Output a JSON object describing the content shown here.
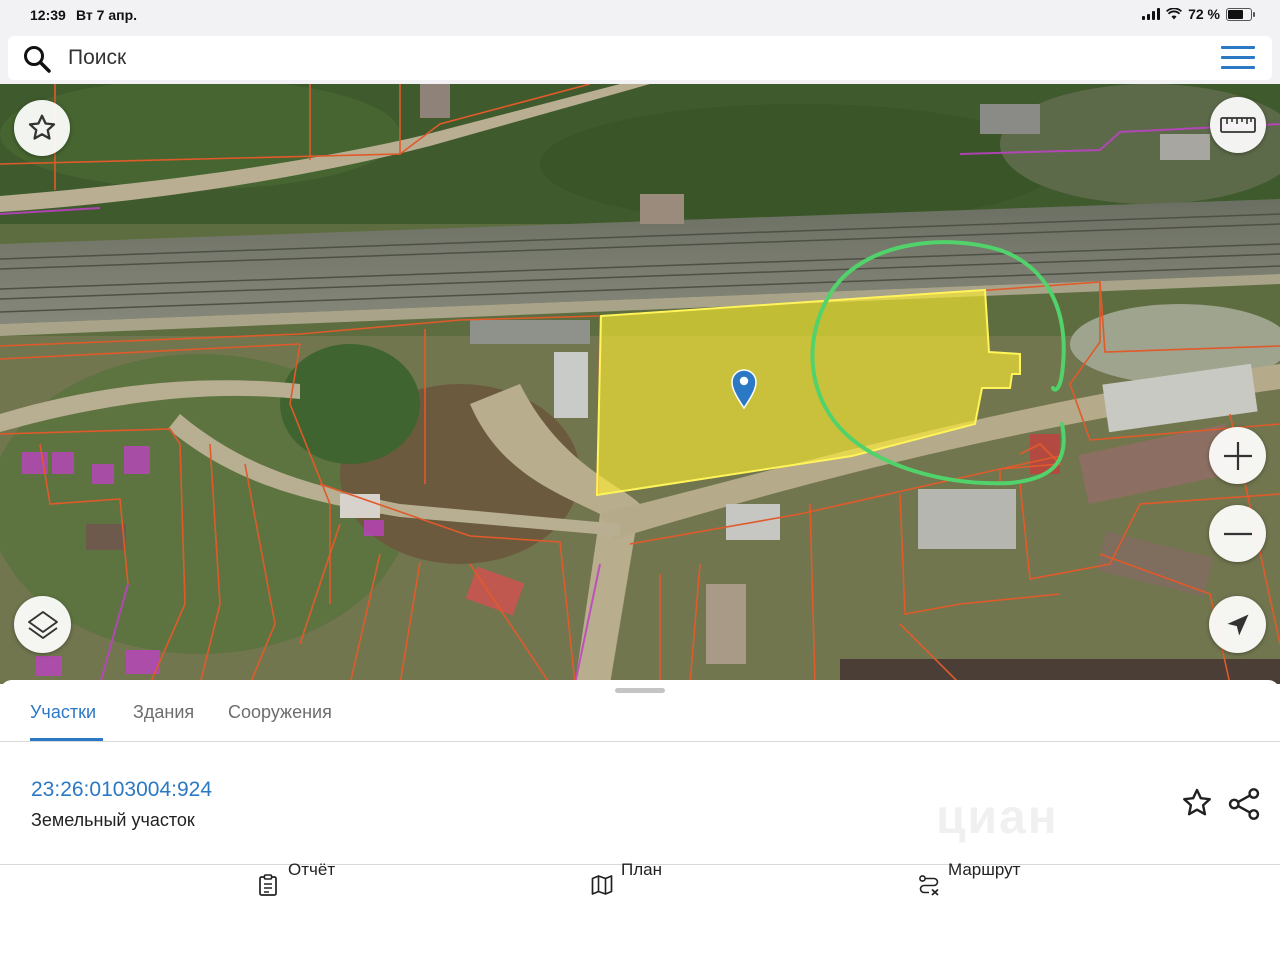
{
  "status": {
    "time": "12:39",
    "date": "Вт 7 апр.",
    "battery": "72 %",
    "battery_level": 0.72
  },
  "search": {
    "placeholder": "Поиск",
    "icon": "search-icon",
    "menu_icon": "menu-icon"
  },
  "map": {
    "controls": {
      "favorite": "star-icon",
      "layers": "layers-icon",
      "ruler": "ruler-icon",
      "zoom_in": "plus-icon",
      "zoom_out": "minus-icon",
      "locate": "location-arrow-icon"
    },
    "colors": {
      "parcel_border": "#e05a2a",
      "selected_fill": "#ffef2e",
      "selected_stroke": "#fff45a",
      "marker": "#2b78c5",
      "annotation": "#52d26a",
      "purple_zone": "#c040c8"
    }
  },
  "panel": {
    "tabs": [
      {
        "label": "Участки",
        "active": true
      },
      {
        "label": "Здания",
        "active": false
      },
      {
        "label": "Сооружения",
        "active": false
      }
    ],
    "cadastral_number": "23:26:0103004:924",
    "object_type": "Земельный участок",
    "actions": [
      {
        "label": "Отчёт",
        "icon": "clipboard-icon"
      },
      {
        "label": "План",
        "icon": "map-icon"
      },
      {
        "label": "Маршрут",
        "icon": "route-icon"
      }
    ],
    "watermark": "циан"
  },
  "colors": {
    "accent": "#2b78c5",
    "inactive_tab": "#6d6d6d"
  }
}
